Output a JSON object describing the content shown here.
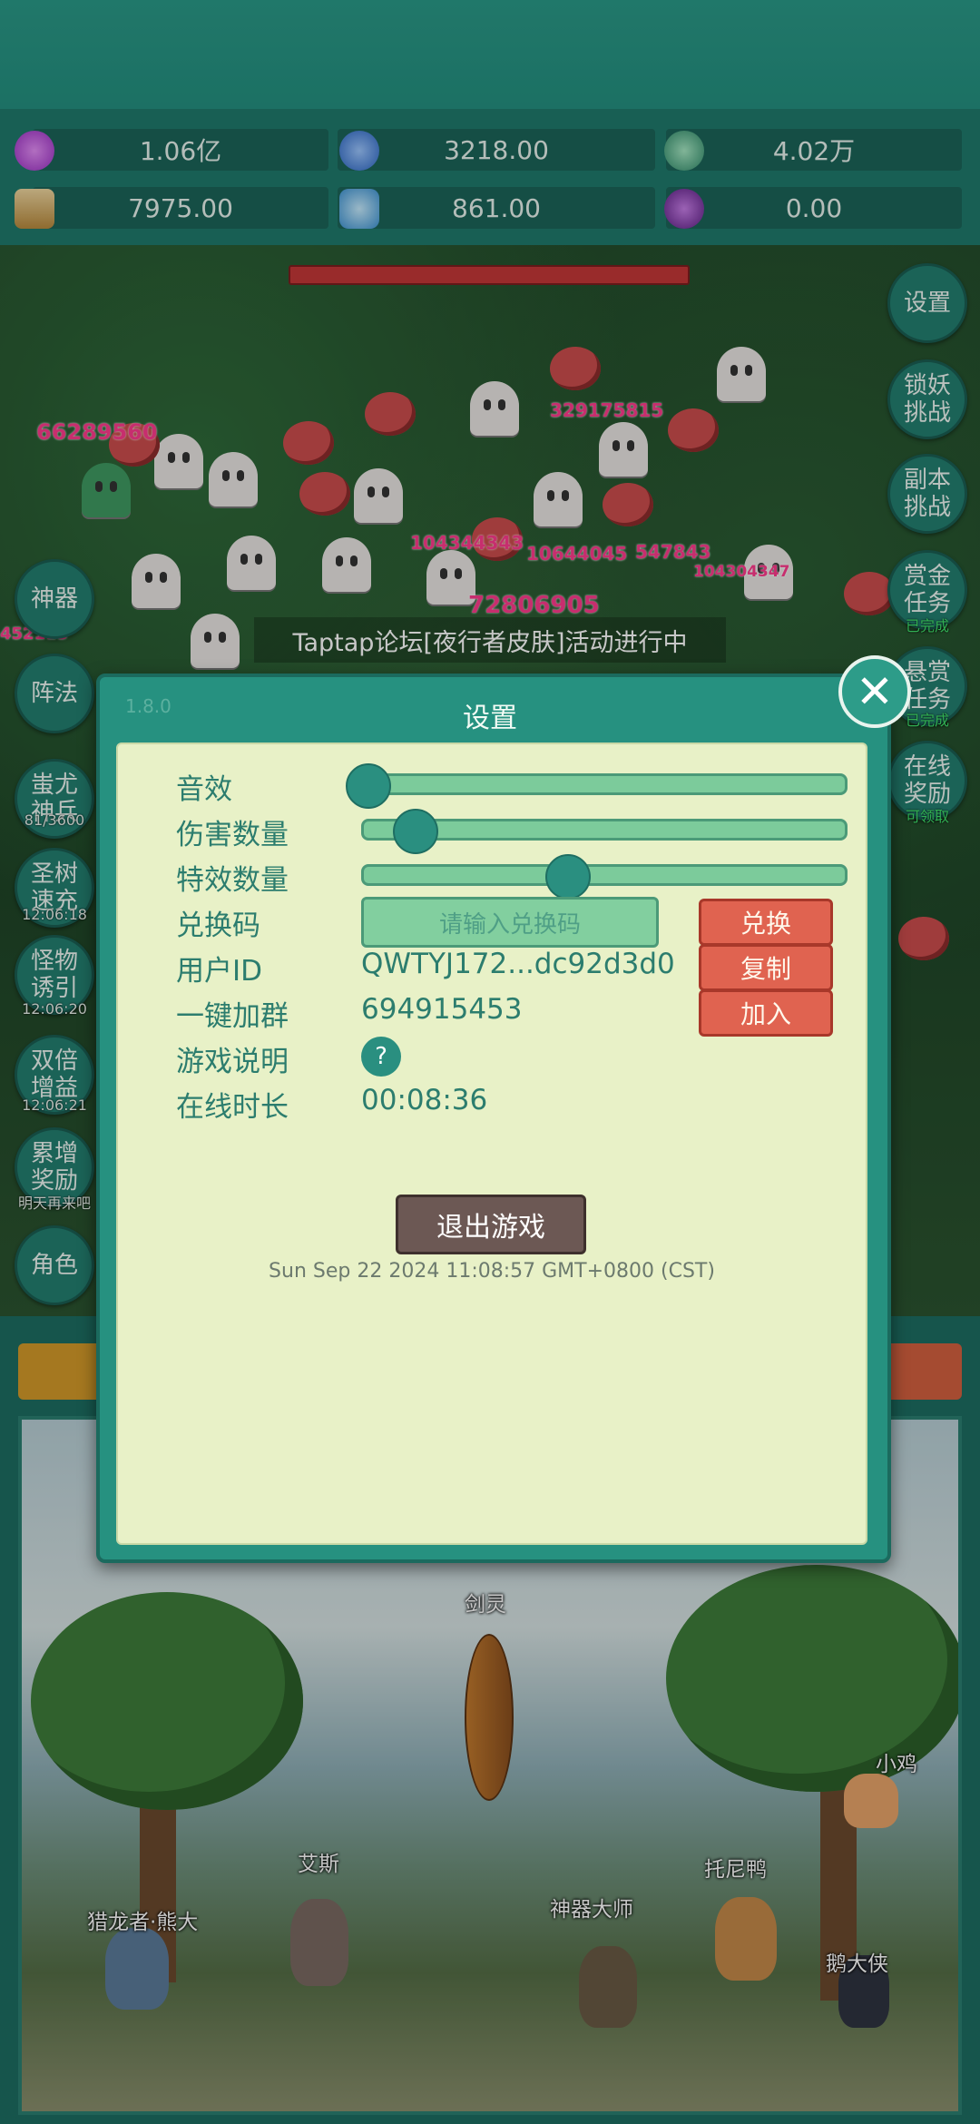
{
  "resources": [
    {
      "icon": "purple-gem-icon",
      "value": "1.06亿",
      "color": "#b43bd6"
    },
    {
      "icon": "blue-orb-icon",
      "value": "3218.00",
      "color": "#3a7ee0"
    },
    {
      "icon": "green-orb-icon",
      "value": "4.02万",
      "color": "#3fb07a"
    },
    {
      "icon": "scroll-icon",
      "value": "7975.00",
      "color": "#d9b069"
    },
    {
      "icon": "ice-crystal-icon",
      "value": "861.00",
      "color": "#58b7e8"
    },
    {
      "icon": "purple-sack-icon",
      "value": "0.00",
      "color": "#8a3fb0"
    }
  ],
  "damage_numbers": [
    "66289560",
    "329175815",
    "104344343",
    "10644045",
    "547843",
    "104304347",
    "72806905",
    "452113"
  ],
  "banner": "Taptap论坛[夜行者皮肤]活动进行中",
  "left_menu": [
    {
      "label": "神器",
      "sub": ""
    },
    {
      "label": "阵法",
      "sub": ""
    },
    {
      "label": "蚩尤\n神兵",
      "sub": "81/3600"
    },
    {
      "label": "圣树\n速充",
      "sub": "12:06:18"
    },
    {
      "label": "怪物\n诱引",
      "sub": "12:06:20"
    },
    {
      "label": "双倍\n增益",
      "sub": "12:06:21"
    },
    {
      "label": "累增\n奖励",
      "sub": "明天再来吧"
    },
    {
      "label": "角色",
      "sub": ""
    }
  ],
  "right_menu": [
    {
      "label": "设置",
      "sub": ""
    },
    {
      "label": "锁妖\n挑战",
      "sub": ""
    },
    {
      "label": "副本\n挑战",
      "sub": ""
    },
    {
      "label": "赏金\n任务",
      "sub": "已完成"
    },
    {
      "label": "悬赏\n任务",
      "sub": "已完成"
    },
    {
      "label": "在线\n奖励",
      "sub": "可领取"
    }
  ],
  "dialog": {
    "version": "1.8.0",
    "title": "设置",
    "sound_label": "音效",
    "sound_level": 0.0,
    "damage_count_label": "伤害数量",
    "damage_count_level": 0.1,
    "effects_count_label": "特效数量",
    "effects_count_level": 0.42,
    "redeem_label": "兑换码",
    "redeem_placeholder": "请输入兑换码",
    "redeem_button": "兑换",
    "user_id_label": "用户ID",
    "user_id_value": "QWTYJ172...dc92d3d0",
    "copy_button": "复制",
    "join_group_label": "一键加群",
    "join_group_value": "694915453",
    "join_button": "加入",
    "help_label": "游戏说明",
    "help_icon": "?",
    "online_time_label": "在线时长",
    "online_time_value": "00:08:36",
    "exit_button": "退出游戏",
    "timestamp": "Sun Sep 22 2024 11:08:57 GMT+0800 (CST)"
  },
  "scene": {
    "item_name": "剑灵",
    "characters": [
      "小鸡",
      "艾斯",
      "托尼鸭",
      "猎龙者·熊大",
      "神器大师",
      "鹅大侠"
    ]
  }
}
